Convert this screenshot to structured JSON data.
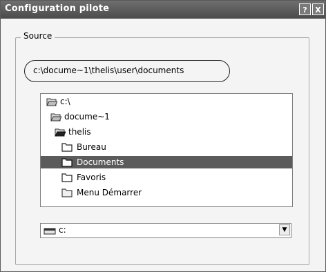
{
  "window": {
    "title": "Configuration pilote",
    "help_label": "?",
    "close_label": "X"
  },
  "group": {
    "legend": "Source",
    "current_path": "c:\\docume~1\\thelis\\user\\documents"
  },
  "folders": [
    {
      "label": "c:\\",
      "icon": "open-folder-icon",
      "indent": 0
    },
    {
      "label": "docume~1",
      "icon": "open-folder-icon",
      "indent": 1
    },
    {
      "label": "thelis",
      "icon": "open-folder-icon",
      "indent": 2
    },
    {
      "label": "Bureau",
      "icon": "folder-icon",
      "indent": 3
    },
    {
      "label": "Documents",
      "icon": "folder-icon",
      "indent": 3,
      "selected": true
    },
    {
      "label": "Favoris",
      "icon": "folder-icon",
      "indent": 3
    },
    {
      "label": "Menu Démarrer",
      "icon": "folder-icon",
      "indent": 3
    }
  ],
  "drive": {
    "selected": "c:",
    "icon": "drive-icon",
    "arrow": "▼"
  },
  "colors": {
    "titlebar": "#5a5a5a",
    "selection": "#5b5b5b"
  }
}
